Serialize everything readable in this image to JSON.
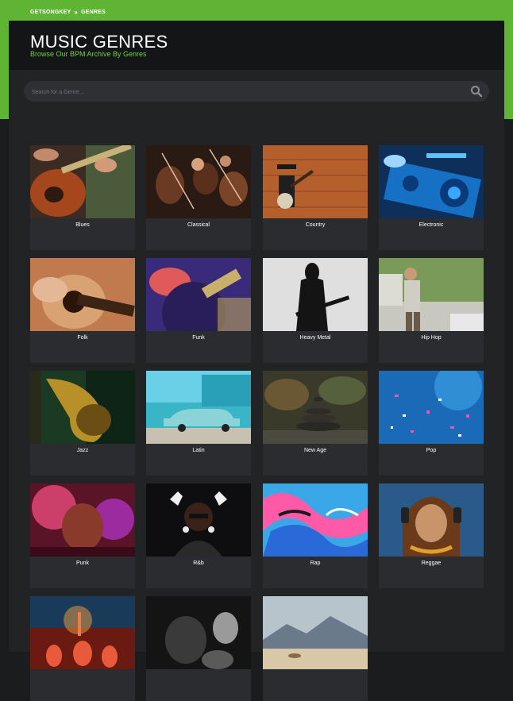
{
  "breadcrumb": {
    "home": "GETSONGKEY",
    "separator": "»",
    "current": "GENRES"
  },
  "header": {
    "title": "MUSIC GENRES",
    "subtitle": "Browse Our BPM Archive By Genres"
  },
  "search": {
    "placeholder": "Search for a Genre..."
  },
  "colors": {
    "accent": "#5fb533",
    "subtitle": "#6ed13f",
    "panel": "#212325",
    "header": "#141517",
    "card": "#2a2c2f"
  },
  "genres": [
    {
      "label": "Blues",
      "image": "guitarist"
    },
    {
      "label": "Classical",
      "image": "orchestra"
    },
    {
      "label": "Country",
      "image": "banjo-player"
    },
    {
      "label": "Electronic",
      "image": "dj-mixer"
    },
    {
      "label": "Folk",
      "image": "acoustic-guitar"
    },
    {
      "label": "Funk",
      "image": "vinyl-record"
    },
    {
      "label": "Heavy Metal",
      "image": "metal-silhouette"
    },
    {
      "label": "Hip Hop",
      "image": "rapper"
    },
    {
      "label": "Jazz",
      "image": "saxophone"
    },
    {
      "label": "Latin",
      "image": "classic-car"
    },
    {
      "label": "New Age",
      "image": "stacked-stones"
    },
    {
      "label": "Pop",
      "image": "confetti"
    },
    {
      "label": "Punk",
      "image": "punk-singer"
    },
    {
      "label": "R&b",
      "image": "singer-with-sunglasses"
    },
    {
      "label": "Rap",
      "image": "graffiti"
    },
    {
      "label": "Reggae",
      "image": "dreadlocks-man"
    },
    {
      "label": "",
      "image": "concert-crowd"
    },
    {
      "label": "",
      "image": "bw-singer"
    },
    {
      "label": "",
      "image": "mountain-landscape"
    }
  ]
}
